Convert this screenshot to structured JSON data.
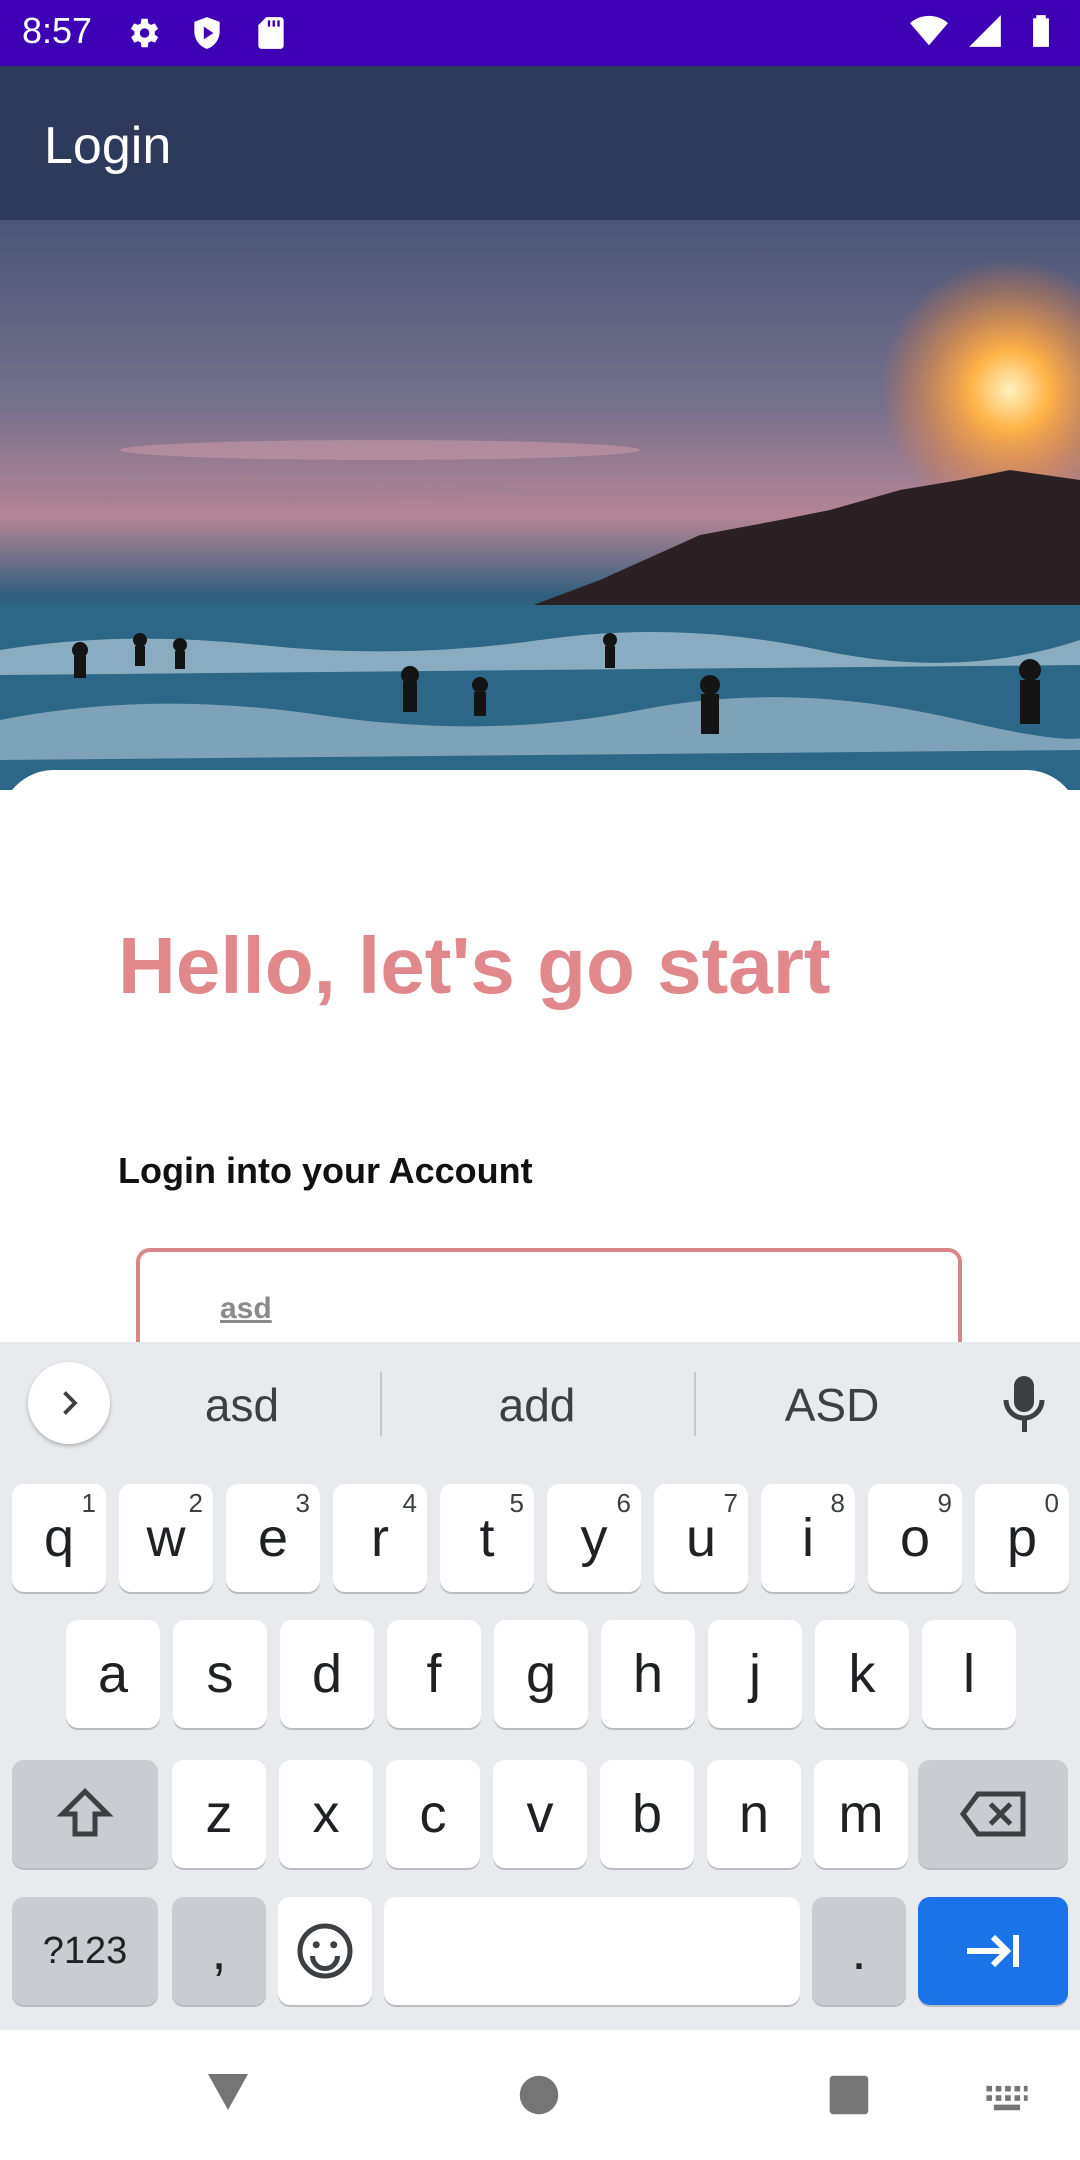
{
  "status_bar": {
    "time": "8:57"
  },
  "app_bar": {
    "title": "Login"
  },
  "card": {
    "headline": "Hello, let's go start",
    "subtitle": "Login into your Account",
    "username_value": "asd"
  },
  "keyboard": {
    "suggestions": [
      "asd",
      "add",
      "ASD"
    ],
    "row1": [
      {
        "k": "q",
        "h": "1"
      },
      {
        "k": "w",
        "h": "2"
      },
      {
        "k": "e",
        "h": "3"
      },
      {
        "k": "r",
        "h": "4"
      },
      {
        "k": "t",
        "h": "5"
      },
      {
        "k": "y",
        "h": "6"
      },
      {
        "k": "u",
        "h": "7"
      },
      {
        "k": "i",
        "h": "8"
      },
      {
        "k": "o",
        "h": "9"
      },
      {
        "k": "p",
        "h": "0"
      }
    ],
    "row2": [
      "a",
      "s",
      "d",
      "f",
      "g",
      "h",
      "j",
      "k",
      "l"
    ],
    "row3": [
      "z",
      "x",
      "c",
      "v",
      "b",
      "n",
      "m"
    ],
    "symbols_label": "?123",
    "comma_label": ",",
    "period_label": "."
  },
  "colors": {
    "status_bar": "#3d00b4",
    "app_bar": "#2e3a5c",
    "accent_pink": "#e0888b",
    "enter_key": "#1a73e8"
  }
}
